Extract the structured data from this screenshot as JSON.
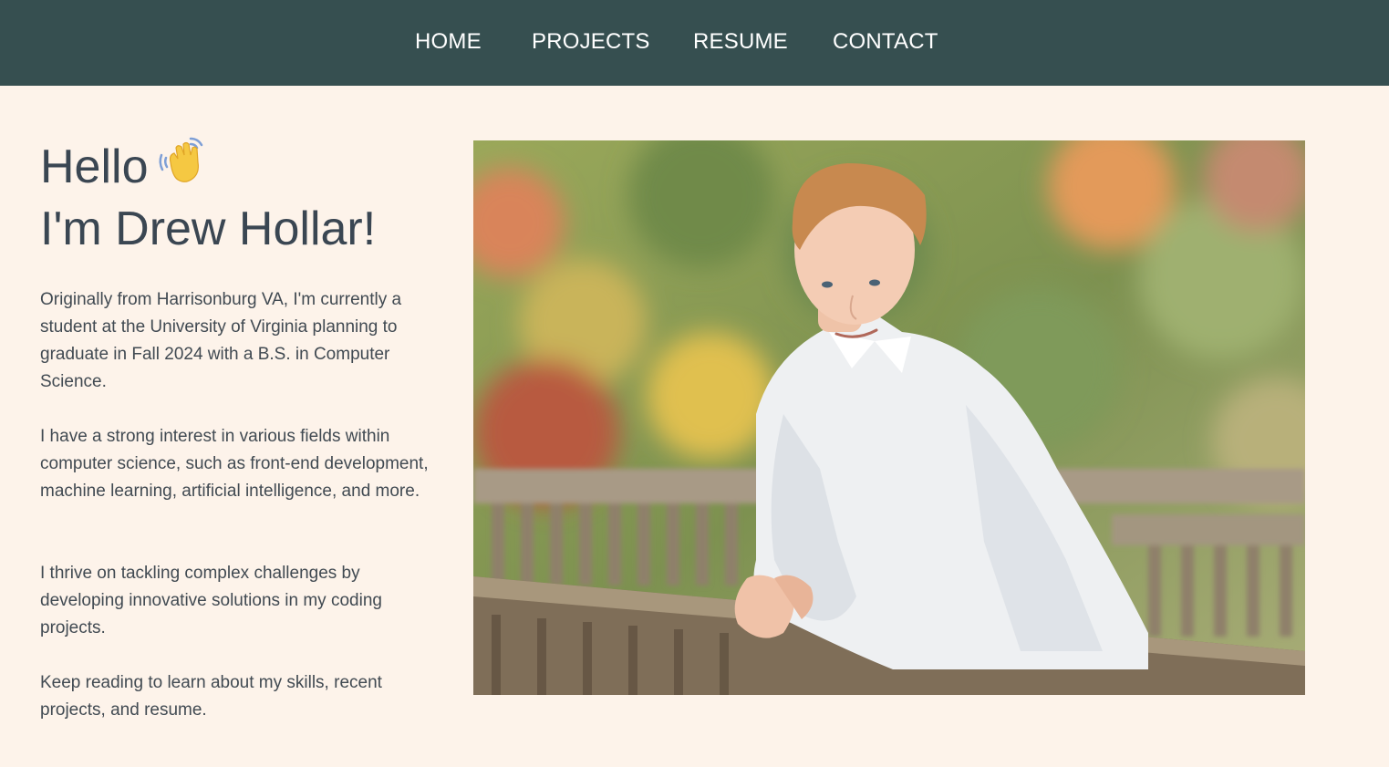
{
  "nav": {
    "items": [
      {
        "label": "HOME"
      },
      {
        "label": "PROJECTS"
      },
      {
        "label": "RESUME"
      },
      {
        "label": "CONTACT"
      }
    ]
  },
  "hero": {
    "greeting": "Hello",
    "greeting_icon": "waving-hand-icon",
    "name_line": "I'm Drew Hollar!"
  },
  "bio": {
    "paragraphs": [
      "Originally from Harrisonburg VA, I'm currently a student at the University of Virginia planning to graduate in Fall 2024 with a B.S. in Computer Science.",
      "I have a strong interest in various fields within computer science, such as front-end development, machine learning, artificial intelligence, and more.",
      "I thrive on tackling complex challenges by developing innovative solutions in my coding projects.",
      "Keep reading to learn about my skills, recent projects, and resume."
    ]
  },
  "colors": {
    "nav_background": "#364f50",
    "page_background": "#fdf3ea",
    "heading_text": "#3a4652",
    "body_text": "#414a52"
  }
}
